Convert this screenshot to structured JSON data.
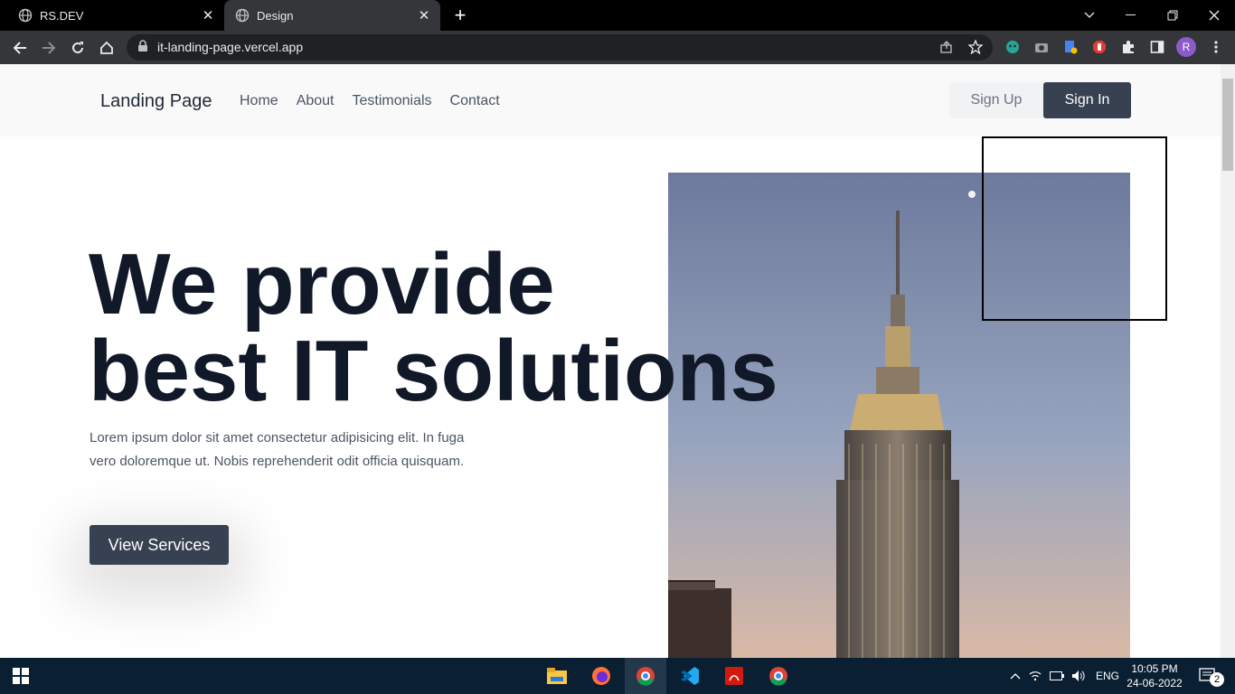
{
  "browser": {
    "tabs": [
      {
        "title": "RS.DEV",
        "active": false
      },
      {
        "title": "Design",
        "active": true
      }
    ],
    "url": "it-landing-page.vercel.app",
    "profile_initial": "R"
  },
  "nav": {
    "brand": "Landing Page",
    "links": [
      "Home",
      "About",
      "Testimonials",
      "Contact"
    ],
    "signup_label": "Sign Up",
    "signin_label": "Sign In"
  },
  "hero": {
    "headline_line1": "We provide",
    "headline_line2": "best IT solutions",
    "lead": "Lorem ipsum dolor sit amet consectetur adipisicing elit. In fuga vero doloremque ut. Nobis reprehenderit odit officia quisquam.",
    "cta_label": "View Services",
    "image": "empire-state-building-photo"
  },
  "taskbar": {
    "language": "ENG",
    "time": "10:05 PM",
    "date": "24-06-2022",
    "notification_count": "2"
  },
  "colors": {
    "primary_button": "#374151",
    "heading": "#111827",
    "taskbar": "#0b1f33"
  }
}
